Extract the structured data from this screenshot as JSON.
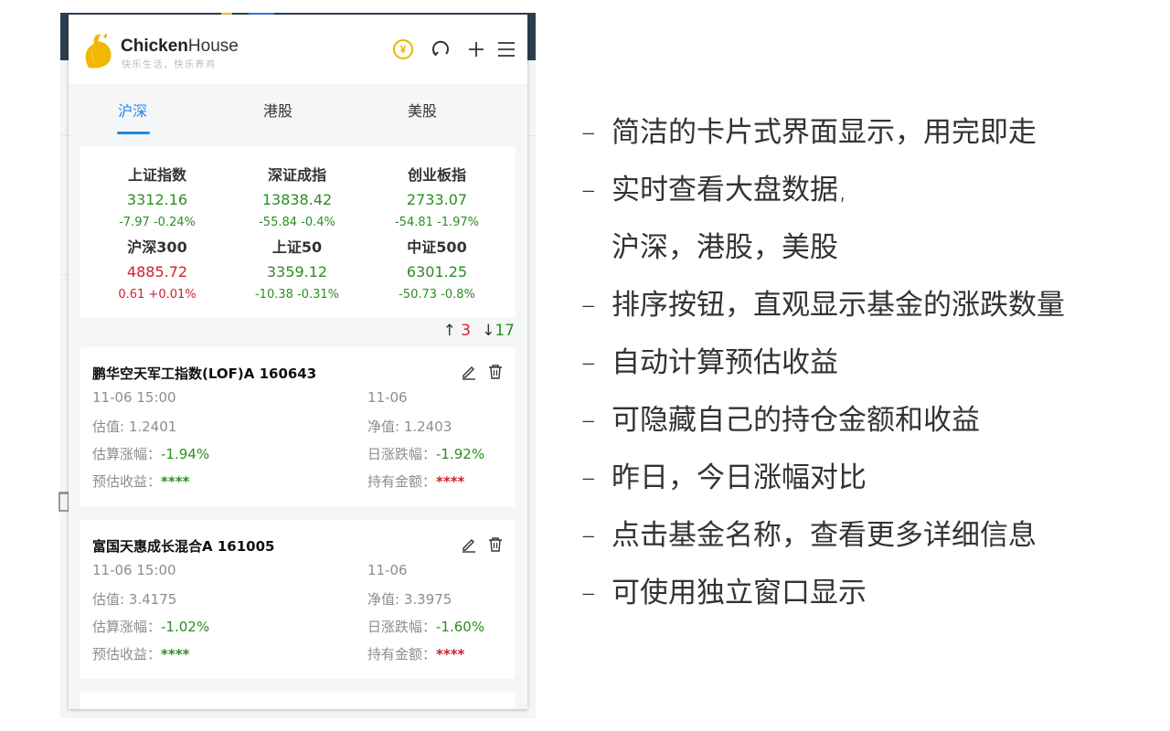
{
  "app": {
    "brand_bold": "Chicken",
    "brand_rest": "House",
    "slogan": "快乐生活，快乐养鸡"
  },
  "header_icons": [
    "yen-icon",
    "refresh-icon",
    "plus-icon",
    "menu-icon"
  ],
  "tabs": [
    {
      "label": "沪深",
      "active": true
    },
    {
      "label": "港股",
      "active": false
    },
    {
      "label": "美股",
      "active": false
    }
  ],
  "indices": [
    {
      "name": "上证指数",
      "value": "3312.16",
      "change": "-7.97 -0.24%",
      "color": "#2a8f1f"
    },
    {
      "name": "深证成指",
      "value": "13838.42",
      "change": "-55.84 -0.4%",
      "color": "#2a8f1f"
    },
    {
      "name": "创业板指",
      "value": "2733.07",
      "change": "-54.81 -1.97%",
      "color": "#2a8f1f"
    },
    {
      "name": "沪深300",
      "value": "4885.72",
      "change": "0.61 +0.01%",
      "color": "#d0202c"
    },
    {
      "name": "上证50",
      "value": "3359.12",
      "change": "-10.38 -0.31%",
      "color": "#2a8f1f"
    },
    {
      "name": "中证500",
      "value": "6301.25",
      "change": "-50.73 -0.8%",
      "color": "#2a8f1f"
    }
  ],
  "counts": {
    "up": "3",
    "down": "17"
  },
  "funds": [
    {
      "title": "鹏华空天军工指数(LOF)A 160643",
      "time_left": "11-06 15:00",
      "time_right": "11-06",
      "est_label": "估值: ",
      "est_value": "1.2401",
      "nav_label": "净值: ",
      "nav_value": "1.2403",
      "est_chg_label": "估算涨幅：",
      "est_chg": "-1.94%",
      "day_chg_label": "日涨跌幅：",
      "day_chg": "-1.92%",
      "profit_label": "预估收益：",
      "profit": "****",
      "holding_label": "持有金额：",
      "holding": "****"
    },
    {
      "title": "富国天惠成长混合A 161005",
      "time_left": "11-06 15:00",
      "time_right": "11-06",
      "est_label": "估值: ",
      "est_value": "3.4175",
      "nav_label": "净值: ",
      "nav_value": "3.3975",
      "est_chg_label": "估算涨幅：",
      "est_chg": "-1.02%",
      "day_chg_label": "日涨跌幅：",
      "day_chg": "-1.60%",
      "profit_label": "预估收益：",
      "profit": "****",
      "holding_label": "持有金额：",
      "holding": "****"
    }
  ],
  "features": {
    "dash": "–",
    "items": [
      "简洁的卡片式界面显示，用完即走",
      "实时查看大盘数据,",
      "沪深，港股，美股",
      "排序按钮，直观显示基金的涨跌数量",
      "自动计算预估收益",
      "可隐藏自己的持仓金额和收益",
      "昨日，今日涨幅对比",
      "点击基金名称，查看更多详细信息",
      "可使用独立窗口显示"
    ]
  }
}
